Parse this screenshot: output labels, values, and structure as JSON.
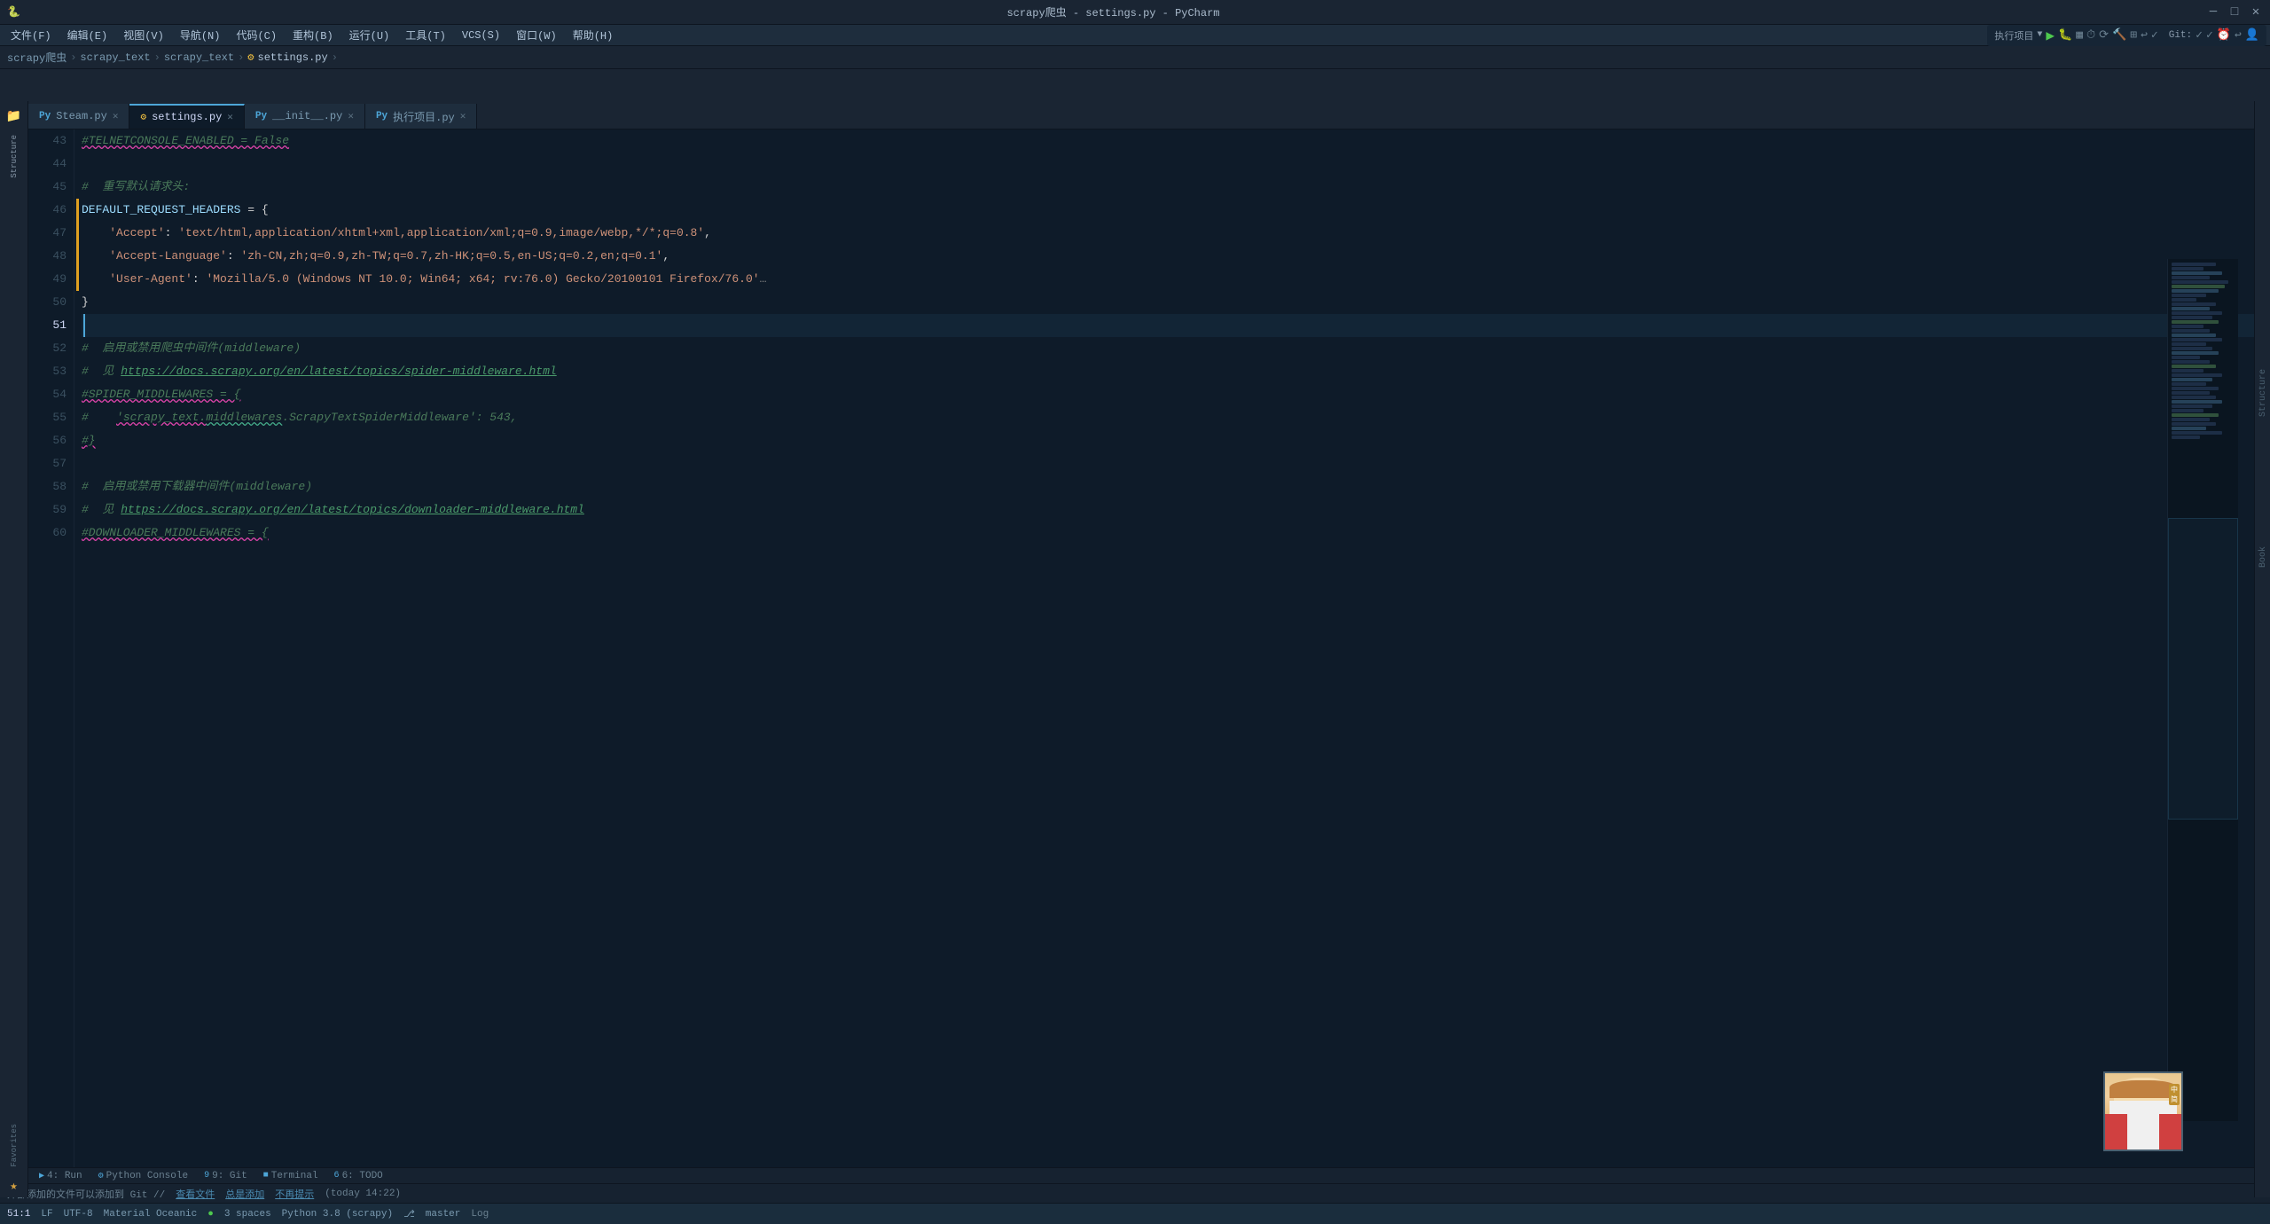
{
  "window": {
    "title": "scrapy爬虫 - settings.py - PyCharm",
    "minimize": "─",
    "maximize": "□",
    "close": "✕"
  },
  "menu": {
    "items": [
      "文件(F)",
      "编辑(E)",
      "视图(V)",
      "导航(N)",
      "代码(C)",
      "重构(B)",
      "运行(U)",
      "工具(T)",
      "VCS(S)",
      "窗口(W)",
      "帮助(H)"
    ]
  },
  "toolbar": {
    "run_config": "执行项目",
    "run_label": "▶",
    "git_label": "Git:",
    "project_name": "scrapy爬虫"
  },
  "breadcrumb": {
    "items": [
      "scrapy爬虫",
      "scrapy_text",
      "scrapy_text",
      "settings.py"
    ]
  },
  "tabs": [
    {
      "label": "Steam.py",
      "type": "py",
      "active": false
    },
    {
      "label": "settings.py",
      "type": "settings",
      "active": true
    },
    {
      "label": "__init__.py",
      "type": "py",
      "active": false
    },
    {
      "label": "执行项目.py",
      "type": "py",
      "active": false
    }
  ],
  "code_lines": [
    {
      "num": "43",
      "content": "#TELNETCONSOLE_ENABLED = False",
      "type": "comment_disabled"
    },
    {
      "num": "44",
      "content": "",
      "type": "empty"
    },
    {
      "num": "45",
      "content": "#  重写默认请求头:",
      "type": "comment"
    },
    {
      "num": "46",
      "content": "DEFAULT_REQUEST_HEADERS = {",
      "type": "code_bracket_start"
    },
    {
      "num": "47",
      "content": "    'Accept': 'text/html,application/xhtml+xml,application/xml;q=0.9,image/webp,*/*;q=0.8',",
      "type": "string_line"
    },
    {
      "num": "48",
      "content": "    'Accept-Language': 'zh-CN,zh;q=0.9,zh-TW;q=0.7,zh-HK;q=0.5,en-US;q=0.2,en;q=0.1',",
      "type": "string_line"
    },
    {
      "num": "49",
      "content": "    'User-Agent': 'Mozilla/5.0 (Windows NT 10.0; Win64; x64; rv:76.0) Gecko/20100101 Firefox/76.0'",
      "type": "string_line_cut"
    },
    {
      "num": "50",
      "content": "}",
      "type": "code_bracket_end"
    },
    {
      "num": "51",
      "content": "",
      "type": "empty_current"
    },
    {
      "num": "52",
      "content": "#  启用或禁用爬虫中间件(middleware)",
      "type": "comment"
    },
    {
      "num": "53",
      "content": "#  见 https://docs.scrapy.org/en/latest/topics/spider-middleware.html",
      "type": "comment_link"
    },
    {
      "num": "54",
      "content": "#SPIDER_MIDDLEWARES = {",
      "type": "comment_disabled"
    },
    {
      "num": "55",
      "content": "#    'scrapy_text.middlewares.ScrapyTextSpiderMiddleware': 543,",
      "type": "comment_disabled"
    },
    {
      "num": "56",
      "content": "#}",
      "type": "comment_disabled"
    },
    {
      "num": "57",
      "content": "",
      "type": "empty"
    },
    {
      "num": "58",
      "content": "#  启用或禁用下载器中间件(middleware)",
      "type": "comment"
    },
    {
      "num": "59",
      "content": "#  见 https://docs.scrapy.org/en/latest/topics/downloader-middleware.html",
      "type": "comment_link"
    },
    {
      "num": "60",
      "content": "#DOWNLOADER_MIDDLEWARES = {",
      "type": "comment_disabled"
    }
  ],
  "status": {
    "position": "51:1",
    "line_ending": "LF",
    "encoding": "UTF-8",
    "theme": "Material Oceanic",
    "indent": "3 spaces",
    "python": "Python 3.8 (scrapy)",
    "branch": "master"
  },
  "info_bar": {
    "external_files": "外部添加的文件可以添加到 Git //",
    "view": "查看文件",
    "total_add": "总是添加",
    "no_more": "不再提示",
    "time": "(today 14:22)"
  },
  "bottom_tabs": [
    {
      "num": "▶",
      "label": "4: Run"
    },
    {
      "num": "⚙",
      "label": "Python Console"
    },
    {
      "num": "9",
      "label": "9: Git"
    },
    {
      "num": "■",
      "label": "Terminal"
    },
    {
      "num": "6",
      "label": "6: TODO"
    }
  ],
  "right_panel_labels": [
    "Structure",
    "Book"
  ],
  "left_panel_labels": [
    "Project",
    "Favorites"
  ],
  "icons": {
    "project": "📁",
    "structure": "≡",
    "favorites": "★"
  }
}
